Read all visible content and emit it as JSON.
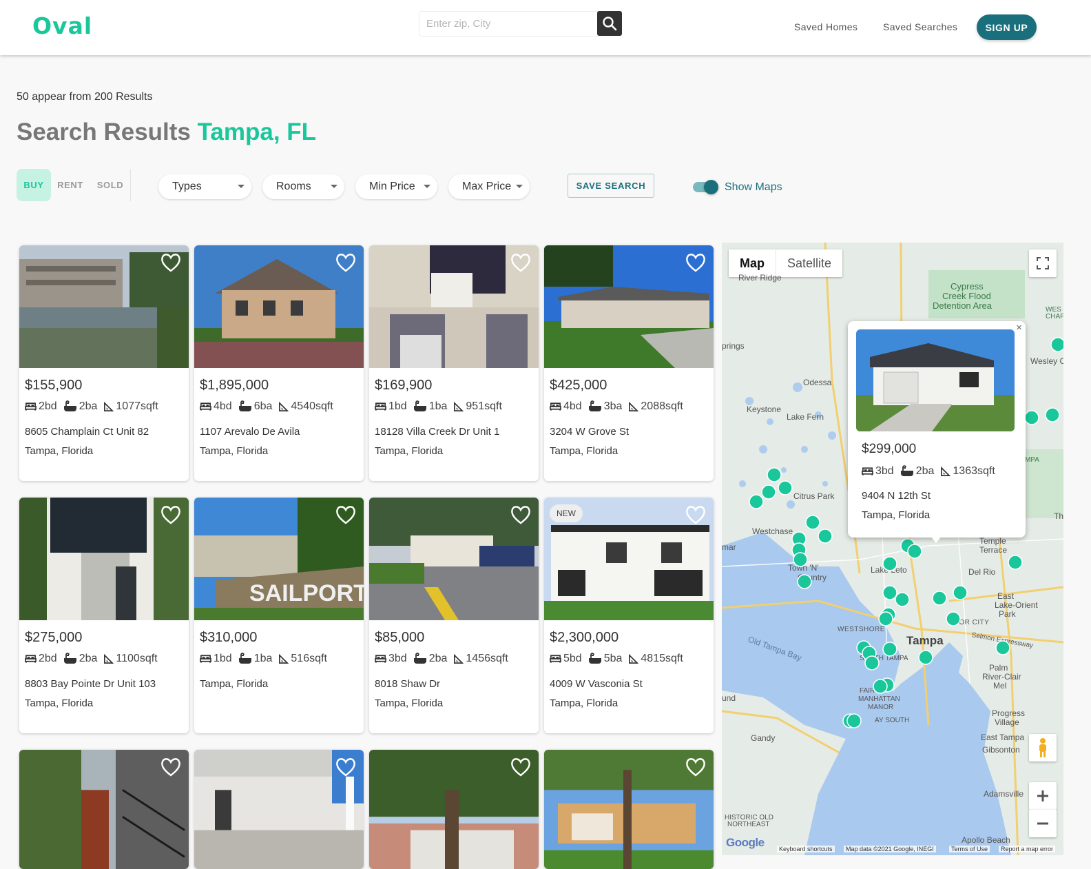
{
  "header": {
    "logo": "Oval",
    "search_placeholder": "Enter zip, City",
    "saved_homes": "Saved Homes",
    "saved_searches": "Saved Searches",
    "signup": "SIGN UP"
  },
  "results": {
    "count_text": "50 appear from 200 Results",
    "title_prefix": "Search Results",
    "title_city": "Tampa, FL"
  },
  "filters": {
    "buy": "BUY",
    "rent": "RENT",
    "sold": "SOLD",
    "types": "Types",
    "rooms": "Rooms",
    "min_price": "Min Price",
    "max_price": "Max Price",
    "save_search": "SAVE SEARCH",
    "show_maps": "Show Maps",
    "show_maps_on": true
  },
  "listings": [
    {
      "price": "$155,900",
      "beds": "2bd",
      "baths": "2ba",
      "sqft": "1077sqft",
      "addr1": "8605 Champlain Ct Unit 82",
      "addr2": "Tampa, Florida"
    },
    {
      "price": "$1,895,000",
      "beds": "4bd",
      "baths": "6ba",
      "sqft": "4540sqft",
      "addr1": "1107 Arevalo De Avila",
      "addr2": "Tampa, Florida"
    },
    {
      "price": "$169,900",
      "beds": "1bd",
      "baths": "1ba",
      "sqft": "951sqft",
      "addr1": "18128 Villa Creek Dr Unit 1",
      "addr2": "Tampa, Florida"
    },
    {
      "price": "$425,000",
      "beds": "4bd",
      "baths": "3ba",
      "sqft": "2088sqft",
      "addr1": "3204 W Grove St",
      "addr2": "Tampa, Florida"
    },
    {
      "price": "$275,000",
      "beds": "2bd",
      "baths": "2ba",
      "sqft": "1100sqft",
      "addr1": "8803 Bay Pointe Dr Unit 103",
      "addr2": "Tampa, Florida"
    },
    {
      "price": "$310,000",
      "beds": "1bd",
      "baths": "1ba",
      "sqft": "516sqft",
      "addr1": "Tampa, Florida",
      "addr2": ""
    },
    {
      "price": "$85,000",
      "beds": "3bd",
      "baths": "2ba",
      "sqft": "1456sqft",
      "addr1": "8018 Shaw Dr",
      "addr2": "Tampa, Florida"
    },
    {
      "price": "$2,300,000",
      "beds": "5bd",
      "baths": "5ba",
      "sqft": "4815sqft",
      "addr1": "4009 W Vasconia St",
      "addr2": "Tampa, Florida",
      "badge": "NEW"
    }
  ],
  "map": {
    "tab_map": "Map",
    "tab_satellite": "Satellite",
    "popup": {
      "price": "$299,000",
      "beds": "3bd",
      "baths": "2ba",
      "sqft": "1363sqft",
      "addr1": "9404 N 12th St",
      "addr2": "Tampa, Florida",
      "close": "×"
    },
    "labels": {
      "cypress": "Cypress",
      "creek_flood": "Creek Flood",
      "detention_area": "Detention Area",
      "odessa": "Odessa",
      "keystone": "Keystone",
      "lake_fern": "Lake Fern",
      "citrus_park": "Citrus Park",
      "westchase": "Westchase",
      "town_n": "Town 'N'",
      "country": "Country",
      "lake_leto": "Lake Leto",
      "tampa": "Tampa",
      "del_rio": "Del Rio",
      "temple": "Temple",
      "terrace": "Terrace",
      "east": "East",
      "lake_orient": "Lake-Orient",
      "park": "Park",
      "westshore": "WESTSHORE",
      "old_tampa_bay": "Old Tampa Bay",
      "palm": "Palm",
      "river_clair": "River-Clair",
      "mel": "Mel",
      "progress": "Progress",
      "village": "Village",
      "east_tampa": "East Tampa",
      "gibsonton": "Gibsonton",
      "gandy": "Gandy",
      "adamsville": "Adamsville",
      "apollo_beach": "Apollo Beach",
      "historic_old": "HISTORIC OLD",
      "northeast": "NORTHEAST",
      "wesley_ch": "Wesley Ch",
      "springs": "prings",
      "river_ridge": "River Ridge",
      "ybor_city": "YBOR CITY",
      "selmon": "Selmon Expressway",
      "fair_oaks": "FAIR O",
      "manhattan": "MANHATTAN",
      "manor": "MANOR",
      "bay_south": "AY SOUTH",
      "south_tampa": "SOUTH TAMPA",
      "mar": "mar",
      "und": "und",
      "the": "Th",
      "wes_chape_1": "WES",
      "wes_chape_2": "CHAPEL",
      "mpa": "MPA"
    },
    "footer": {
      "google": "Google",
      "shortcuts": "Keyboard shortcuts",
      "data": "Map data ©2021 Google, INEGI",
      "terms": "Terms of Use",
      "report": "Report a map error"
    },
    "pin_color": "#19c79a"
  },
  "colors": {
    "accent": "#19c79a",
    "primary": "#1a6f7c"
  }
}
